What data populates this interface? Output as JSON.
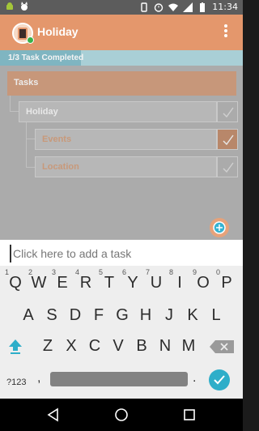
{
  "status_bar": {
    "time": "11:34",
    "left_icons": [
      "android-icon",
      "cat-icon"
    ],
    "right_icons": [
      "vibrate-icon",
      "alarm-icon",
      "wifi-icon",
      "signal-icon",
      "battery-icon"
    ]
  },
  "app_bar": {
    "title": "Holiday",
    "menu_icon": "overflow-menu-icon",
    "accent": "#e4976c"
  },
  "progress": {
    "label": "1/3 Task Completed",
    "completed": 1,
    "total": 3
  },
  "tree": {
    "header": "Tasks",
    "items": [
      {
        "label": "Holiday",
        "level": 1,
        "completed": false
      },
      {
        "label": "Events",
        "level": 2,
        "completed": true
      },
      {
        "label": "Location",
        "level": 2,
        "completed": false
      }
    ]
  },
  "add_task": {
    "placeholder": "Click here to add a task",
    "value": ""
  },
  "keyboard": {
    "row1": [
      {
        "key": "Q",
        "hint": "1"
      },
      {
        "key": "W",
        "hint": "2"
      },
      {
        "key": "E",
        "hint": "3"
      },
      {
        "key": "R",
        "hint": "4"
      },
      {
        "key": "T",
        "hint": "5"
      },
      {
        "key": "Y",
        "hint": "6"
      },
      {
        "key": "U",
        "hint": "7"
      },
      {
        "key": "I",
        "hint": "8"
      },
      {
        "key": "O",
        "hint": "9"
      },
      {
        "key": "P",
        "hint": "0"
      }
    ],
    "row2": [
      "A",
      "S",
      "D",
      "F",
      "G",
      "H",
      "J",
      "K",
      "L"
    ],
    "row3": [
      "Z",
      "X",
      "C",
      "V",
      "B",
      "N",
      "M"
    ],
    "symbols_label": "?123",
    "comma": ",",
    "period": "."
  },
  "colors": {
    "progress_bg": "#a9cfd6",
    "progress_fill": "#7fb5c1",
    "task_header": "#c7977a",
    "check_done": "#b8876a",
    "enter_key": "#2eaec9"
  }
}
